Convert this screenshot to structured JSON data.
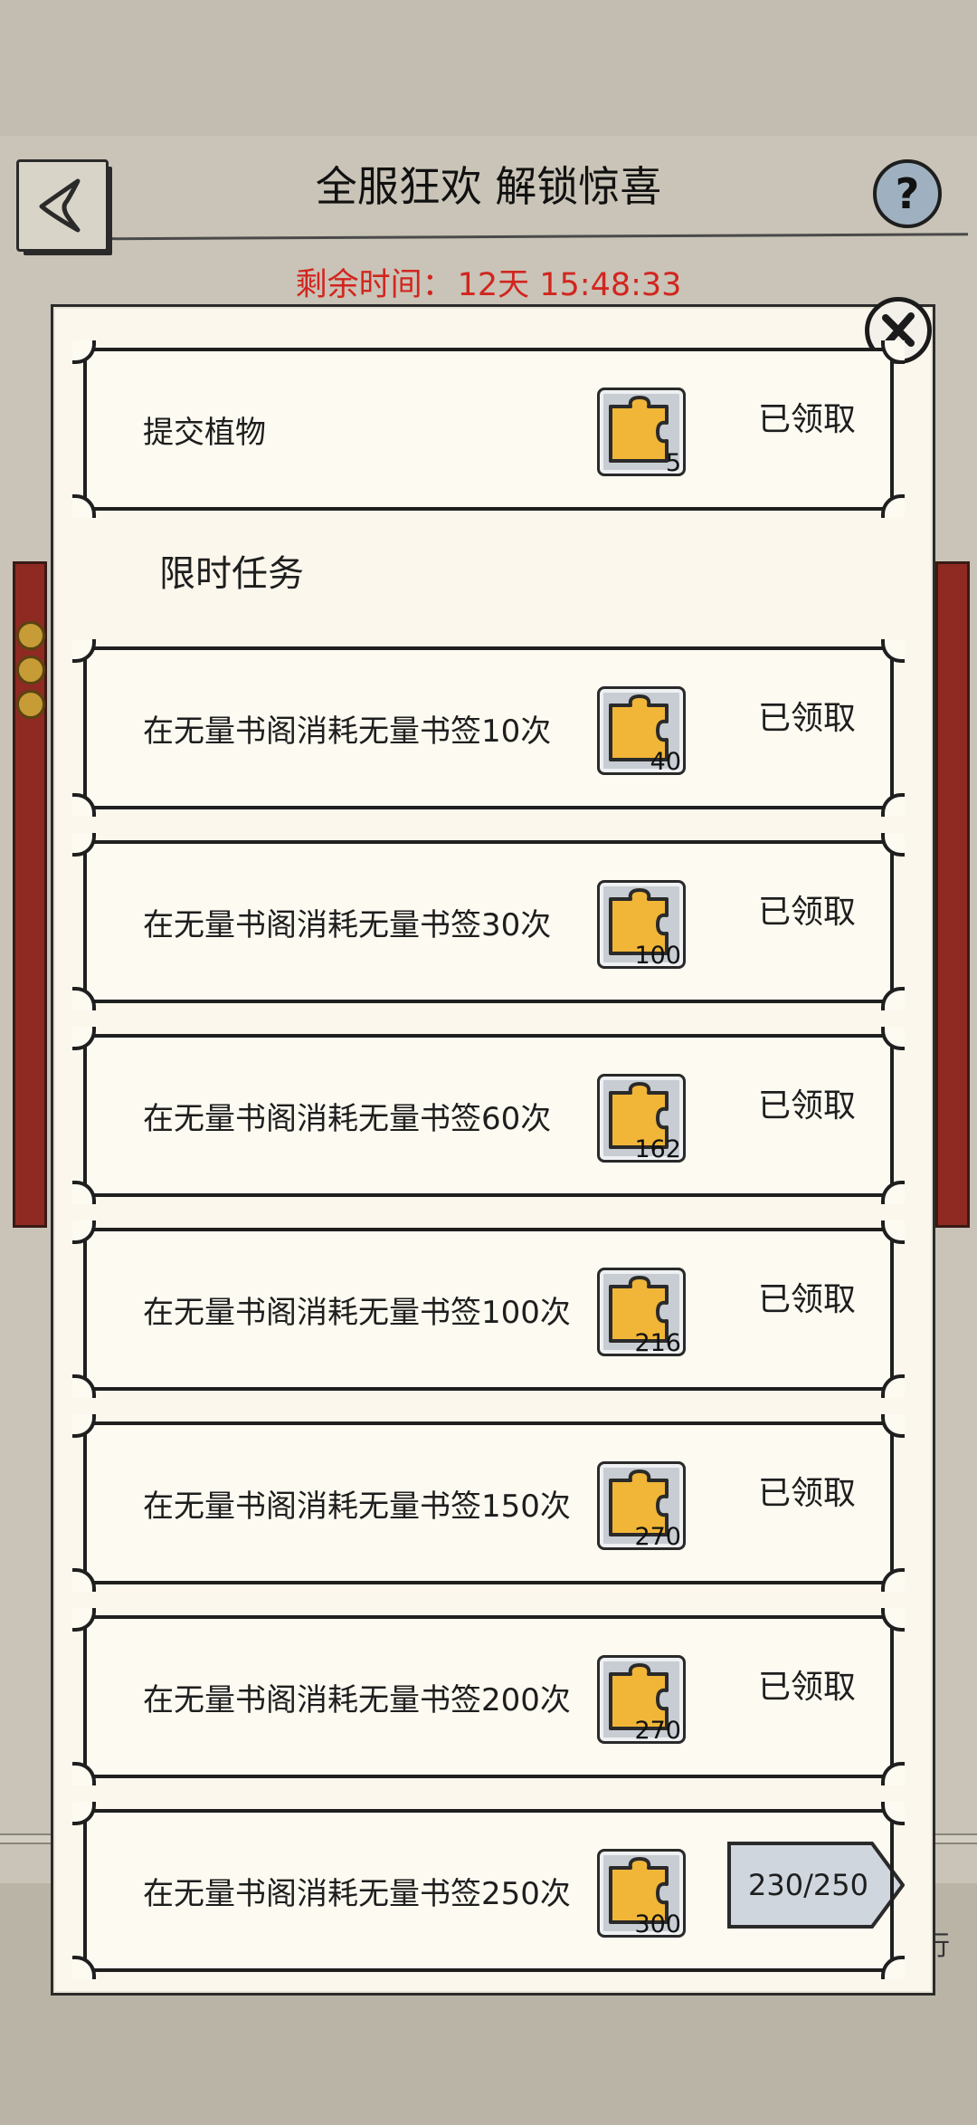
{
  "header": {
    "title": "全服狂欢 解锁惊喜",
    "timer_label": "剩余时间：",
    "timer_value": "12天 15:48:33"
  },
  "side": {
    "right_label": "行"
  },
  "top_card": {
    "text": "提交植物",
    "reward": "5",
    "status": "已领取"
  },
  "section": {
    "title": "限时任务"
  },
  "tasks": [
    {
      "text": "在无量书阁消耗无量书签10次",
      "reward": "40",
      "status": "已领取"
    },
    {
      "text": "在无量书阁消耗无量书签30次",
      "reward": "100",
      "status": "已领取"
    },
    {
      "text": "在无量书阁消耗无量书签60次",
      "reward": "162",
      "status": "已领取"
    },
    {
      "text": "在无量书阁消耗无量书签100次",
      "reward": "216",
      "status": "已领取"
    },
    {
      "text": "在无量书阁消耗无量书签150次",
      "reward": "270",
      "status": "已领取"
    },
    {
      "text": "在无量书阁消耗无量书签200次",
      "reward": "270",
      "status": "已领取"
    },
    {
      "text": "在无量书阁消耗无量书签250次",
      "reward": "300",
      "progress": "230/250"
    }
  ],
  "icons": {
    "back": "back-arrow-icon",
    "help": "question-icon",
    "close": "close-icon",
    "reward": "puzzle-piece-icon"
  },
  "colors": {
    "timer": "#d1261f",
    "accent_gold": "#f1b638",
    "card_bg": "#fdfaf1"
  }
}
